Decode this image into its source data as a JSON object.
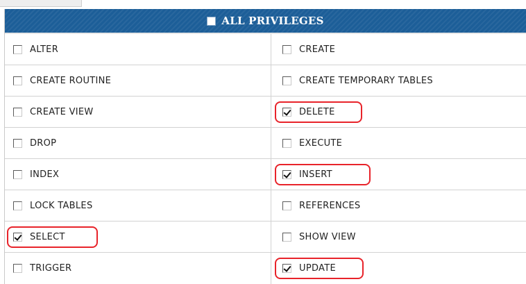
{
  "header": {
    "label": "ALL PRIVILEGES",
    "checked": false
  },
  "privileges": [
    {
      "label": "ALTER",
      "checked": false,
      "highlighted": false
    },
    {
      "label": "CREATE",
      "checked": false,
      "highlighted": false
    },
    {
      "label": "CREATE ROUTINE",
      "checked": false,
      "highlighted": false
    },
    {
      "label": "CREATE TEMPORARY TABLES",
      "checked": false,
      "highlighted": false
    },
    {
      "label": "CREATE VIEW",
      "checked": false,
      "highlighted": false
    },
    {
      "label": "DELETE",
      "checked": true,
      "highlighted": true
    },
    {
      "label": "DROP",
      "checked": false,
      "highlighted": false
    },
    {
      "label": "EXECUTE",
      "checked": false,
      "highlighted": false
    },
    {
      "label": "INDEX",
      "checked": false,
      "highlighted": false
    },
    {
      "label": "INSERT",
      "checked": true,
      "highlighted": true
    },
    {
      "label": "LOCK TABLES",
      "checked": false,
      "highlighted": false
    },
    {
      "label": "REFERENCES",
      "checked": false,
      "highlighted": false
    },
    {
      "label": "SELECT",
      "checked": true,
      "highlighted": true
    },
    {
      "label": "SHOW VIEW",
      "checked": false,
      "highlighted": false
    },
    {
      "label": "TRIGGER",
      "checked": false,
      "highlighted": false
    },
    {
      "label": "UPDATE",
      "checked": true,
      "highlighted": true
    }
  ],
  "colors": {
    "header_bg": "#1c5e98",
    "highlight": "#e8232a"
  }
}
